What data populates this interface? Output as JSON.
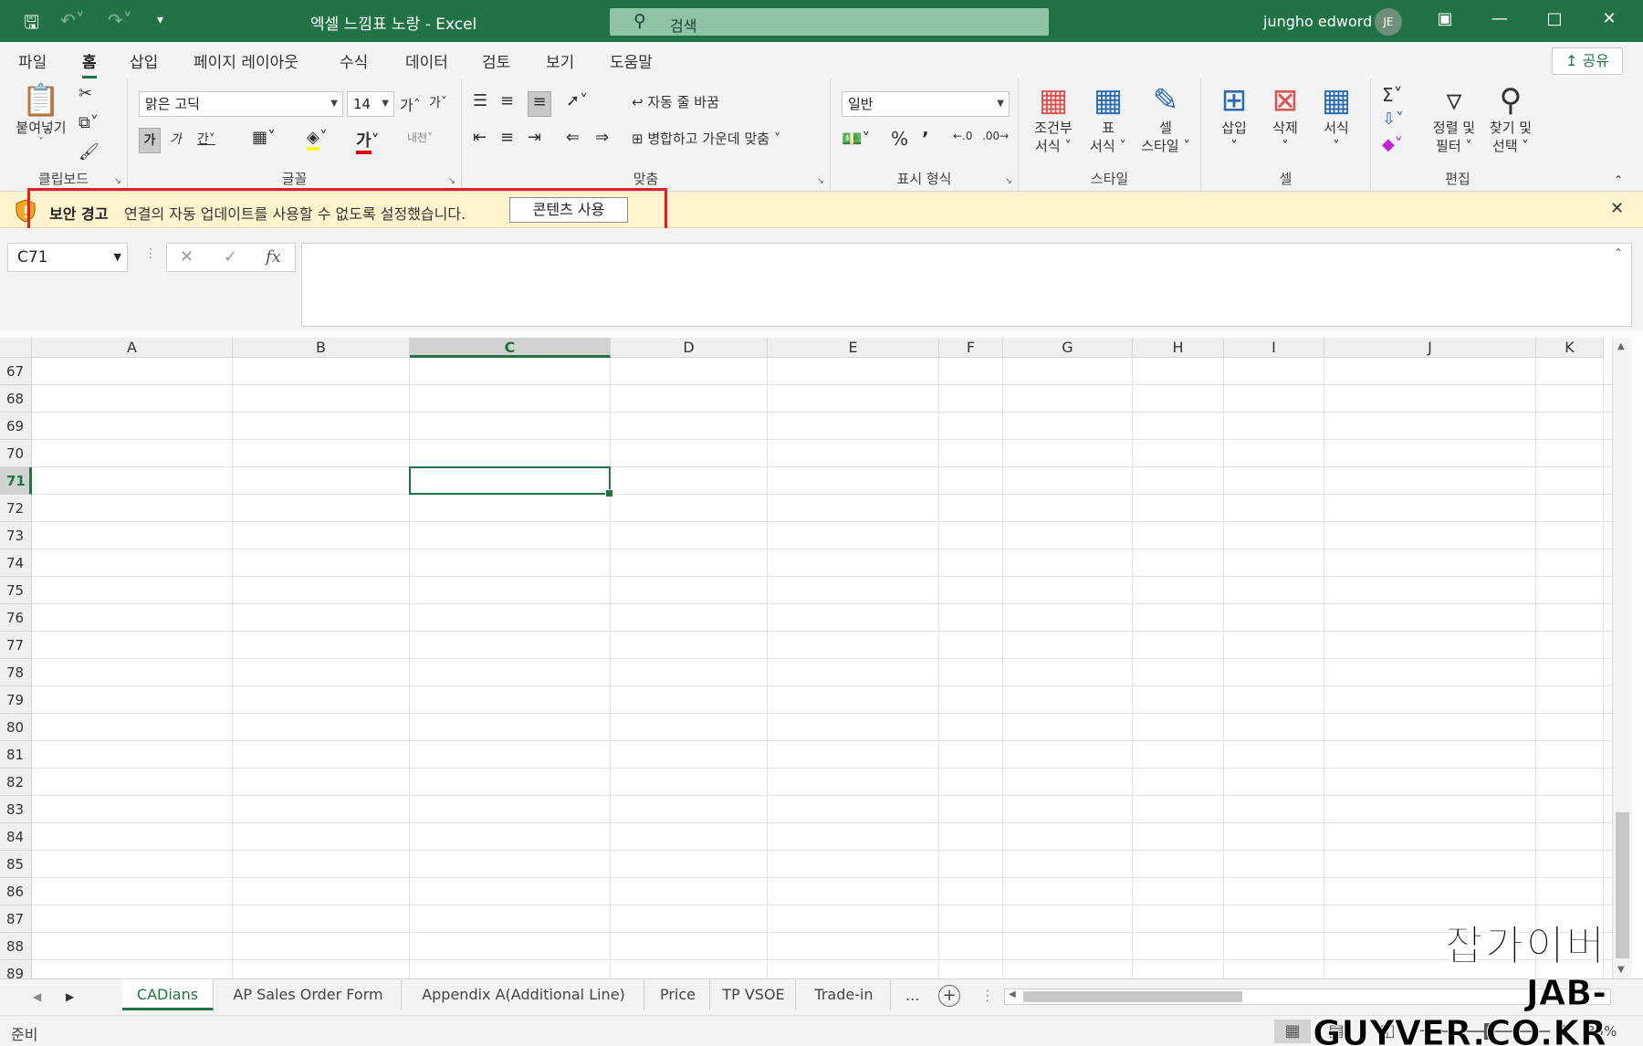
{
  "app": {
    "title": "엑셀 느낌표 노랑  -  Excel",
    "search_placeholder": "검색",
    "user_name": "jungho edword",
    "user_initials": "JE",
    "accent_color": "#217346"
  },
  "ribbon_tabs": [
    "파일",
    "홈",
    "삽입",
    "페이지 레이아웃",
    "수식",
    "데이터",
    "검토",
    "보기",
    "도움말"
  ],
  "share_label": "공유",
  "ribbon": {
    "clipboard": {
      "paste": "붙여넣기",
      "label": "클립보드"
    },
    "font": {
      "name": "맑은 고딕",
      "size": "14",
      "label": "글꼴"
    },
    "alignment": {
      "wrap": "자동 줄 바꿈",
      "merge": "병합하고 가운데 맞춤",
      "label": "맞춤"
    },
    "number": {
      "format": "일반",
      "label": "표시 형식"
    },
    "styles": {
      "conditional_1": "조건부",
      "conditional_2": "서식",
      "table_1": "표",
      "table_2": "서식",
      "cell_1": "셀",
      "cell_2": "스타일",
      "label": "스타일"
    },
    "cells": {
      "insert": "삽입",
      "delete": "삭제",
      "format": "서식",
      "label": "셀"
    },
    "editing": {
      "sort_1": "정렬 및",
      "sort_2": "필터",
      "find_1": "찾기 및",
      "find_2": "선택",
      "label": "편집"
    }
  },
  "security_bar": {
    "title": "보안 경고",
    "message": "연결의 자동 업데이트를 사용할 수 없도록 설정했습니다.",
    "button": "콘텐츠 사용"
  },
  "formula_bar": {
    "name_box": "C71",
    "formula": ""
  },
  "grid": {
    "columns": [
      "A",
      "B",
      "C",
      "D",
      "E",
      "F",
      "G",
      "H",
      "I",
      "J",
      "K"
    ],
    "rows": [
      "67",
      "68",
      "69",
      "70",
      "71",
      "72",
      "73",
      "74",
      "75",
      "76",
      "77",
      "78",
      "79",
      "80",
      "81",
      "82",
      "83",
      "84",
      "85",
      "86",
      "87",
      "88",
      "89"
    ],
    "selected_column": "C",
    "selected_row": "71"
  },
  "sheets": [
    "CADians",
    "AP Sales Order Form",
    "Appendix A(Additional Line)",
    "Price",
    "TP VSOE",
    "Trade-in"
  ],
  "active_sheet": "CADians",
  "more_sheets": "...",
  "status": {
    "text": "준비",
    "zoom": "85%",
    "zoom_value": 85
  },
  "watermark": {
    "line1": "잡가이버",
    "line2": "JAB-GUYVER.CO.KR"
  }
}
